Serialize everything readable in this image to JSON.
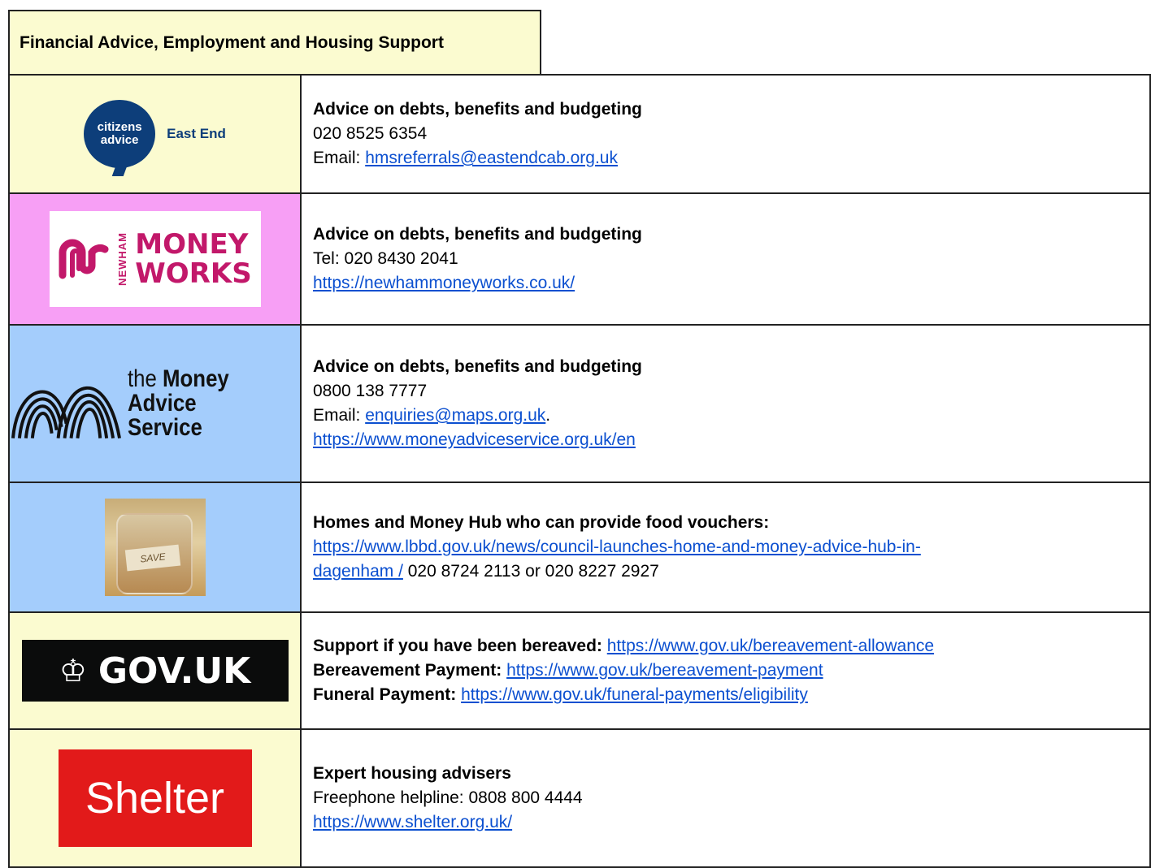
{
  "header": {
    "title": "Financial Advice, Employment and Housing Support"
  },
  "rows": [
    {
      "logo": {
        "line1": "citizens",
        "line2": "advice",
        "tag": "East End"
      },
      "heading": "Advice on debts, benefits and budgeting",
      "phone": "020 8525 6354",
      "email_label": "Email: ",
      "email": "hmsreferrals@eastendcab.org.uk"
    },
    {
      "logo": {
        "vertical": "NEWHAM",
        "line1": "MONEY",
        "line2": "WORKS"
      },
      "heading": "Advice on debts, benefits and budgeting",
      "phone": "Tel: 020 8430 2041",
      "url": "https://newhammoneyworks.co.uk/"
    },
    {
      "logo": {
        "line1": "the",
        "line1b": "Money",
        "line2": "Advice Service"
      },
      "heading": "Advice on debts, benefits and budgeting",
      "phone": "0800 138 7777",
      "email_label": "Email: ",
      "email": "enquiries@maps.org.uk",
      "email_suffix": ".",
      "url": "https://www.moneyadviceservice.org.uk/en"
    },
    {
      "logo": {
        "jar_label": "SAVE"
      },
      "heading": "Homes and Money Hub who can provide food vouchers:",
      "url_part1": "https://www.lbbd.gov.uk/news/council-launches-home-and-money-advice-hub-in-",
      "url_part2": "dagenham /",
      "phones": " 020 8724 2113 or 020 8227 2927"
    },
    {
      "logo": {
        "text": "GOV.UK",
        "crown": "♔"
      },
      "line1_label": "Support if you have been bereaved: ",
      "line1_url": "https://www.gov.uk/bereavement-allowance",
      "line2_label": "Bereavement Payment: ",
      "line2_url": "https://www.gov.uk/bereavement-payment",
      "line3_label": "Funeral Payment: ",
      "line3_url": "https://www.gov.uk/funeral-payments/eligibility"
    },
    {
      "logo": {
        "text": "Shelter"
      },
      "heading": "Expert housing advisers",
      "phone": "Freephone helpline: 0808 800 4444",
      "url": "https://www.shelter.org.uk/"
    }
  ]
}
